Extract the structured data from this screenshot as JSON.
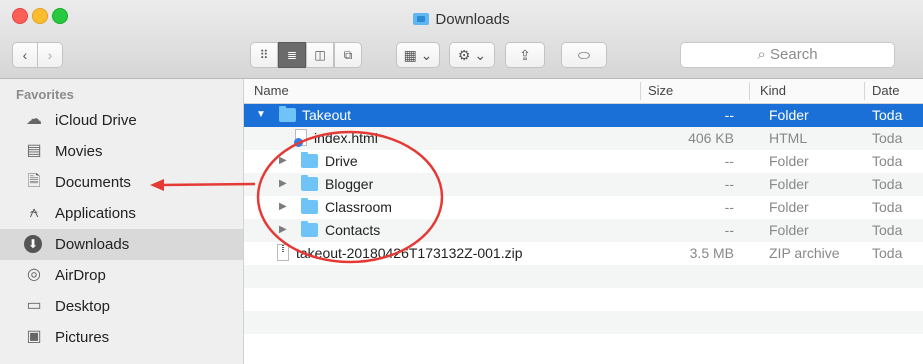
{
  "window": {
    "title": "Downloads"
  },
  "toolbar": {
    "back": "‹",
    "forward": "›",
    "search_placeholder": "Search",
    "view_icons": "⠿",
    "view_list": "≣",
    "view_columns": "◫",
    "view_gallery": "⧉",
    "arrange": "▦ ⌄",
    "action": "⚙ ⌄",
    "share": "⇪",
    "tags": "⬭",
    "search_icon": "⌕"
  },
  "sidebar": {
    "header": "Favorites",
    "items": [
      {
        "label": "iCloud Drive",
        "icon": "☁",
        "icon_name": "cloud-icon"
      },
      {
        "label": "Movies",
        "icon": "▤",
        "icon_name": "film-icon"
      },
      {
        "label": "Documents",
        "icon": "🗎",
        "icon_name": "document-icon"
      },
      {
        "label": "Applications",
        "icon": "⍲",
        "icon_name": "applications-icon"
      },
      {
        "label": "Downloads",
        "icon": "⬇",
        "icon_name": "download-icon"
      },
      {
        "label": "AirDrop",
        "icon": "◎",
        "icon_name": "airdrop-icon"
      },
      {
        "label": "Desktop",
        "icon": "▭",
        "icon_name": "desktop-icon"
      },
      {
        "label": "Pictures",
        "icon": "▣",
        "icon_name": "camera-icon"
      }
    ]
  },
  "columns": {
    "name": "Name",
    "size": "Size",
    "kind": "Kind",
    "date": "Date"
  },
  "files": [
    {
      "name": "Takeout",
      "size": "--",
      "kind": "Folder",
      "date": "Toda"
    },
    {
      "name": "index.html",
      "size": "406 KB",
      "kind": "HTML",
      "date": "Toda"
    },
    {
      "name": "Drive",
      "size": "--",
      "kind": "Folder",
      "date": "Toda"
    },
    {
      "name": "Blogger",
      "size": "--",
      "kind": "Folder",
      "date": "Toda"
    },
    {
      "name": "Classroom",
      "size": "--",
      "kind": "Folder",
      "date": "Toda"
    },
    {
      "name": "Contacts",
      "size": "--",
      "kind": "Folder",
      "date": "Toda"
    },
    {
      "name": "takeout-20180426T173132Z-001.zip",
      "size": "3.5 MB",
      "kind": "ZIP archive",
      "date": "Toda"
    }
  ],
  "colors": {
    "selection": "#1a70d6",
    "annotation": "#e53935",
    "folder": "#6fc3f7"
  }
}
